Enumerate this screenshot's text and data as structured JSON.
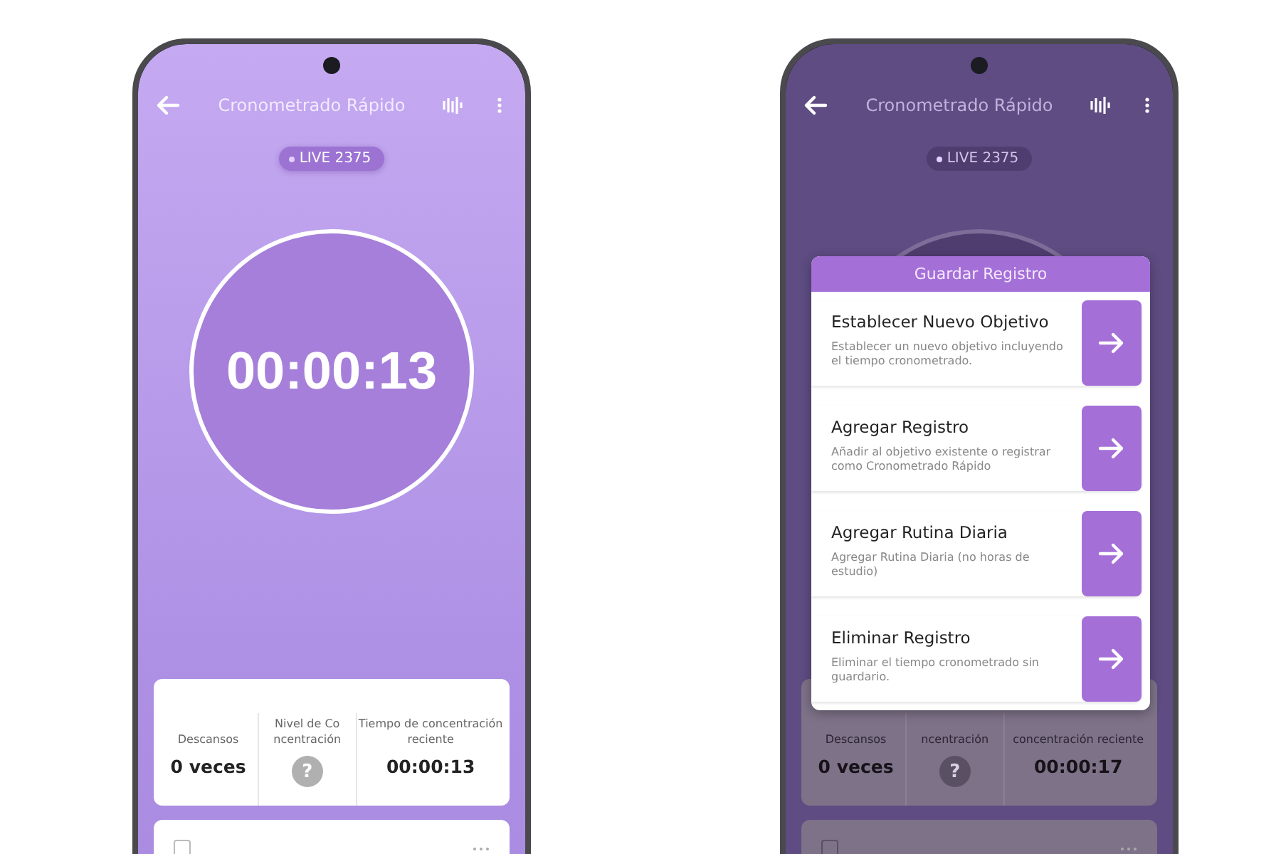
{
  "phones": [
    {
      "dimmed": false,
      "title": "Cronometrado Rápido",
      "live": "LIVE 2375",
      "timer": "00:00:13",
      "stats": [
        {
          "kind": "text",
          "label": "Descansos",
          "value": "0 veces"
        },
        {
          "kind": "unknown",
          "label": "Nivel de Co ncentración",
          "value": "?"
        },
        {
          "kind": "text",
          "label": "Tiempo de concentración reciente",
          "value": "00:00:13"
        }
      ],
      "record": {
        "checked": false
      }
    },
    {
      "dimmed": true,
      "title": "Cronometrado Rápido",
      "live": "LIVE 2375",
      "stats": [
        {
          "kind": "text",
          "label": "Descansos",
          "value": "0 veces"
        },
        {
          "kind": "unknown",
          "label": "ncentración",
          "value": "?"
        },
        {
          "kind": "text",
          "label": "concentración reciente",
          "value": "00:00:17"
        }
      ],
      "record": {
        "checked": false
      },
      "dialog": {
        "title": "Guardar Registro",
        "options": [
          {
            "title": "Establecer Nuevo Objetivo",
            "description": "Establecer un nuevo objetivo incluyendo el tiempo cronometrado."
          },
          {
            "title": "Agregar Registro",
            "description": "Añadir al objetivo existente o registrar como Cronometrado Rápido"
          },
          {
            "title": "Agregar Rutina Diaria",
            "description": "Agregar Rutina Diaria (no horas de estudio)"
          },
          {
            "title": "Eliminar Registro",
            "description": "Eliminar el tiempo cronometrado sin guardario."
          }
        ]
      }
    }
  ]
}
